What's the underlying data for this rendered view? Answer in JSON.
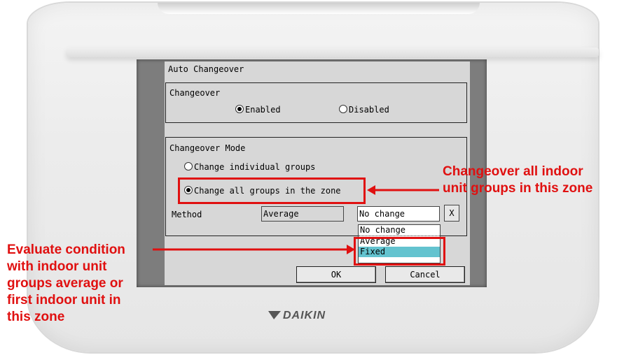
{
  "dialog": {
    "title": "Auto Changeover",
    "changeover": {
      "label": "Changeover",
      "enabled": "Enabled",
      "disabled": "Disabled",
      "selected": "Enabled"
    },
    "mode": {
      "label": "Changeover Mode",
      "option_individual": "Change individual groups",
      "option_all": "Change all groups in the zone",
      "selected": "Change all groups in the zone"
    },
    "method": {
      "label": "Method",
      "value": "Average",
      "select_value": "No change",
      "clear_label": "X",
      "options": [
        "No change",
        "Average",
        "Fixed"
      ],
      "highlighted": "Fixed"
    },
    "ok_label": "OK",
    "cancel_label": "Cancel"
  },
  "annotations": {
    "right_line1": "Changeover all indoor",
    "right_line2": "unit groups in this zone",
    "left_line1": "Evaluate condition",
    "left_line2": "with indoor unit",
    "left_line3": "groups average or",
    "left_line4": "first indoor unit in",
    "left_line5": "this zone"
  },
  "brand": "DAIKIN",
  "colors": {
    "annotation_red": "#e01010",
    "highlight": "#63c3cf"
  }
}
